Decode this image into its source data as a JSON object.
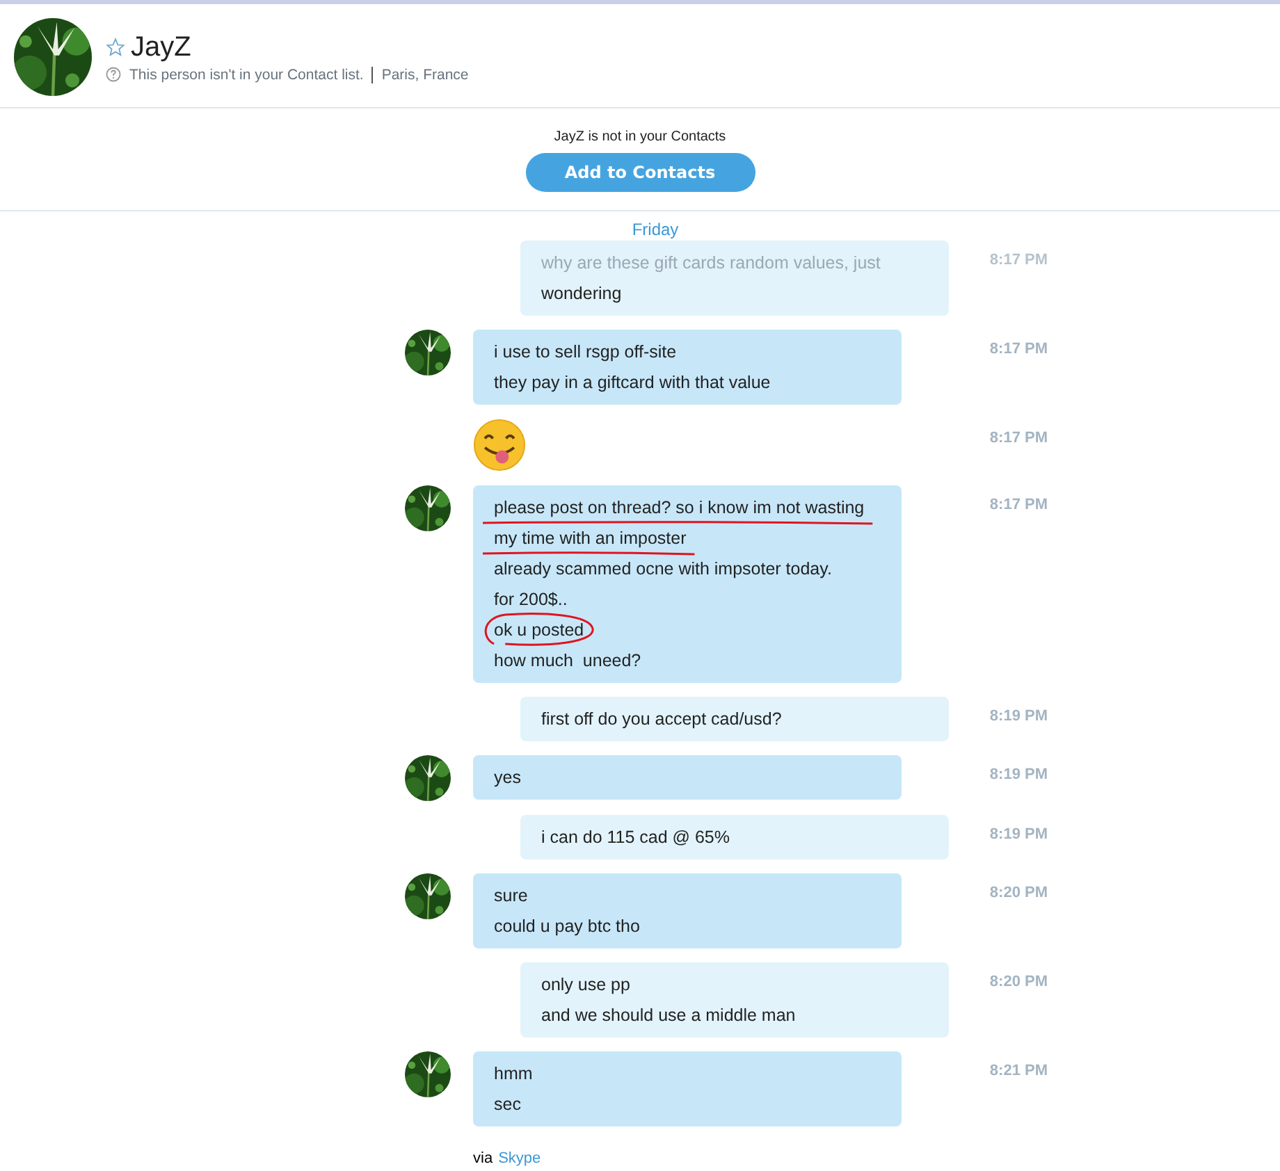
{
  "header": {
    "name": "JayZ",
    "favorite": false,
    "status": "This person isn't in your Contact list.",
    "location": "Paris, France"
  },
  "notice": {
    "text": "JayZ is not in your Contacts",
    "button": "Add to Contacts"
  },
  "day": "Friday",
  "messages": [
    {
      "kind": "outgoing",
      "time": "8:17 PM",
      "lines": [
        {
          "text": "why are these gift cards random values, just",
          "faded": true
        },
        {
          "text": "wondering"
        }
      ]
    },
    {
      "kind": "incoming",
      "time": "8:17 PM",
      "lines": [
        {
          "text": "i use to sell rsgp off-site"
        },
        {
          "text": "they pay in a giftcard with that value"
        }
      ]
    },
    {
      "kind": "emoji",
      "time": "8:17 PM"
    },
    {
      "kind": "incoming",
      "time": "8:17 PM",
      "lines": [
        {
          "text": "please post on thread? so i know im not wasting",
          "underlined": true
        },
        {
          "text": "my time with an imposter",
          "underlined": true
        },
        {
          "text": "already scammed ocne with impsoter today."
        },
        {
          "text": "for 200$.."
        },
        {
          "text": "ok u posted",
          "circled": true
        },
        {
          "text": "how much  uneed?"
        }
      ]
    },
    {
      "kind": "outgoing",
      "time": "8:19 PM",
      "lines": [
        {
          "text": "first off do you accept cad/usd?"
        }
      ]
    },
    {
      "kind": "incoming",
      "time": "8:19 PM",
      "lines": [
        {
          "text": "yes"
        }
      ]
    },
    {
      "kind": "outgoing",
      "time": "8:19 PM",
      "lines": [
        {
          "text": "i can do 115 cad @ 65%"
        }
      ]
    },
    {
      "kind": "incoming",
      "time": "8:20 PM",
      "lines": [
        {
          "text": "sure"
        },
        {
          "text": "could u pay btc tho"
        }
      ]
    },
    {
      "kind": "outgoing",
      "time": "8:20 PM",
      "lines": [
        {
          "text": "only use pp"
        },
        {
          "text": "and we should use a middle man"
        }
      ]
    },
    {
      "kind": "incoming",
      "time": "8:21 PM",
      "lines": [
        {
          "text": "hmm"
        },
        {
          "text": "sec"
        }
      ]
    }
  ],
  "footer": {
    "prefix": "via",
    "link": "Skype"
  }
}
